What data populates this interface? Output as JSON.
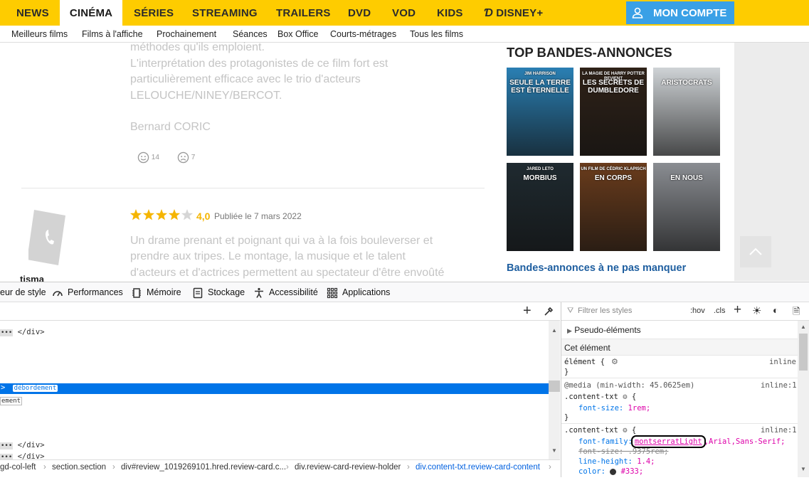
{
  "nav": {
    "items": [
      "NEWS",
      "CINÉMA",
      "SÉRIES",
      "STREAMING",
      "TRAILERS",
      "DVD",
      "VOD",
      "KIDS"
    ],
    "disney": "DISNEY+",
    "account": "MON COMPTE"
  },
  "subnav": [
    "Meilleurs films",
    "Films à l'affiche",
    "Prochainement",
    "Séances",
    "Box Office",
    "Courts-métrages",
    "Tous les films"
  ],
  "review1": {
    "lines": [
      "méthodes qu'ils emploient.",
      "L'interprétation des protagonistes de ce film fort est",
      "particulièrement efficace avec le trio d'acteurs",
      "LELOUCHE/NINEY/BERCOT."
    ],
    "author": "Bernard CORIC",
    "likes": "14",
    "dislikes": "7"
  },
  "review2": {
    "score": "4,0",
    "rating": 4,
    "date": "Publiée le 7 mars 2022",
    "lines": [
      "Un drame prenant et poignant qui va à la fois bouleverser et",
      "prendre aux tripes. Le montage, la musique et le talent",
      "d'acteurs et d'actrices permettent au spectateur d'être envoûté"
    ],
    "user": "tisma"
  },
  "sidebar": {
    "title": "TOP BANDES-ANNONCES",
    "posters": [
      {
        "top": "JIM HARRISON",
        "title": "SEULE LA TERRE EST ÉTERNELLE",
        "color": "#2a7fb3"
      },
      {
        "top": "LA MAGIE DE HARRY POTTER REVIENT",
        "title": "LES SECRETS DE DUMBLEDORE",
        "color": "#2f2218"
      },
      {
        "top": "",
        "title": "ARISTOCRATS",
        "color": "#cfd3d6"
      },
      {
        "top": "JARED LETO",
        "title": "MORBIUS",
        "color": "#1f2a30"
      },
      {
        "top": "UN FILM DE CÉDRIC KLAPISCH",
        "title": "EN CORPS",
        "color": "#6a3c1c"
      },
      {
        "top": "",
        "title": "EN NOUS",
        "color": "#8a8d92"
      }
    ],
    "more": "Bandes-annonces à ne pas manquer"
  },
  "devtools": {
    "tabs": [
      "eur de style",
      "Performances",
      "Mémoire",
      "Stockage",
      "Accessibilité",
      "Applications"
    ],
    "filter_placeholder": "Filtrer les styles",
    "hov": ":hov",
    "cls": ".cls",
    "pseudo": "Pseudo-éléments",
    "this_element": "Cet élément",
    "element_rule": "élément {",
    "inline": "inline",
    "media": "@media (min-width: 45.0625em)",
    "inline1": "inline:1",
    "sel1": ".content-txt",
    "fs_prop": "font-size:",
    "fs_val": "1rem;",
    "sel2": ".content-txt",
    "ff_prop": "font-family:",
    "ff_val1": "montserratLight",
    "ff_val2": ",Arial,Sans-Serif;",
    "fs2": "font-size: .9375rem;",
    "lh_prop": "line-height:",
    "lh_val": "1.4;",
    "color_prop": "color:",
    "color_val": "#333;",
    "closing_div": "</div>",
    "overflow_badge": "débordement",
    "ement": "ement",
    "breadcrumbs": [
      "gd-col-left",
      "section.section",
      "div#review_1019269101.hred.review-card.c...",
      "div.review-card-review-holder",
      "div.content-txt.review-card-content"
    ]
  }
}
